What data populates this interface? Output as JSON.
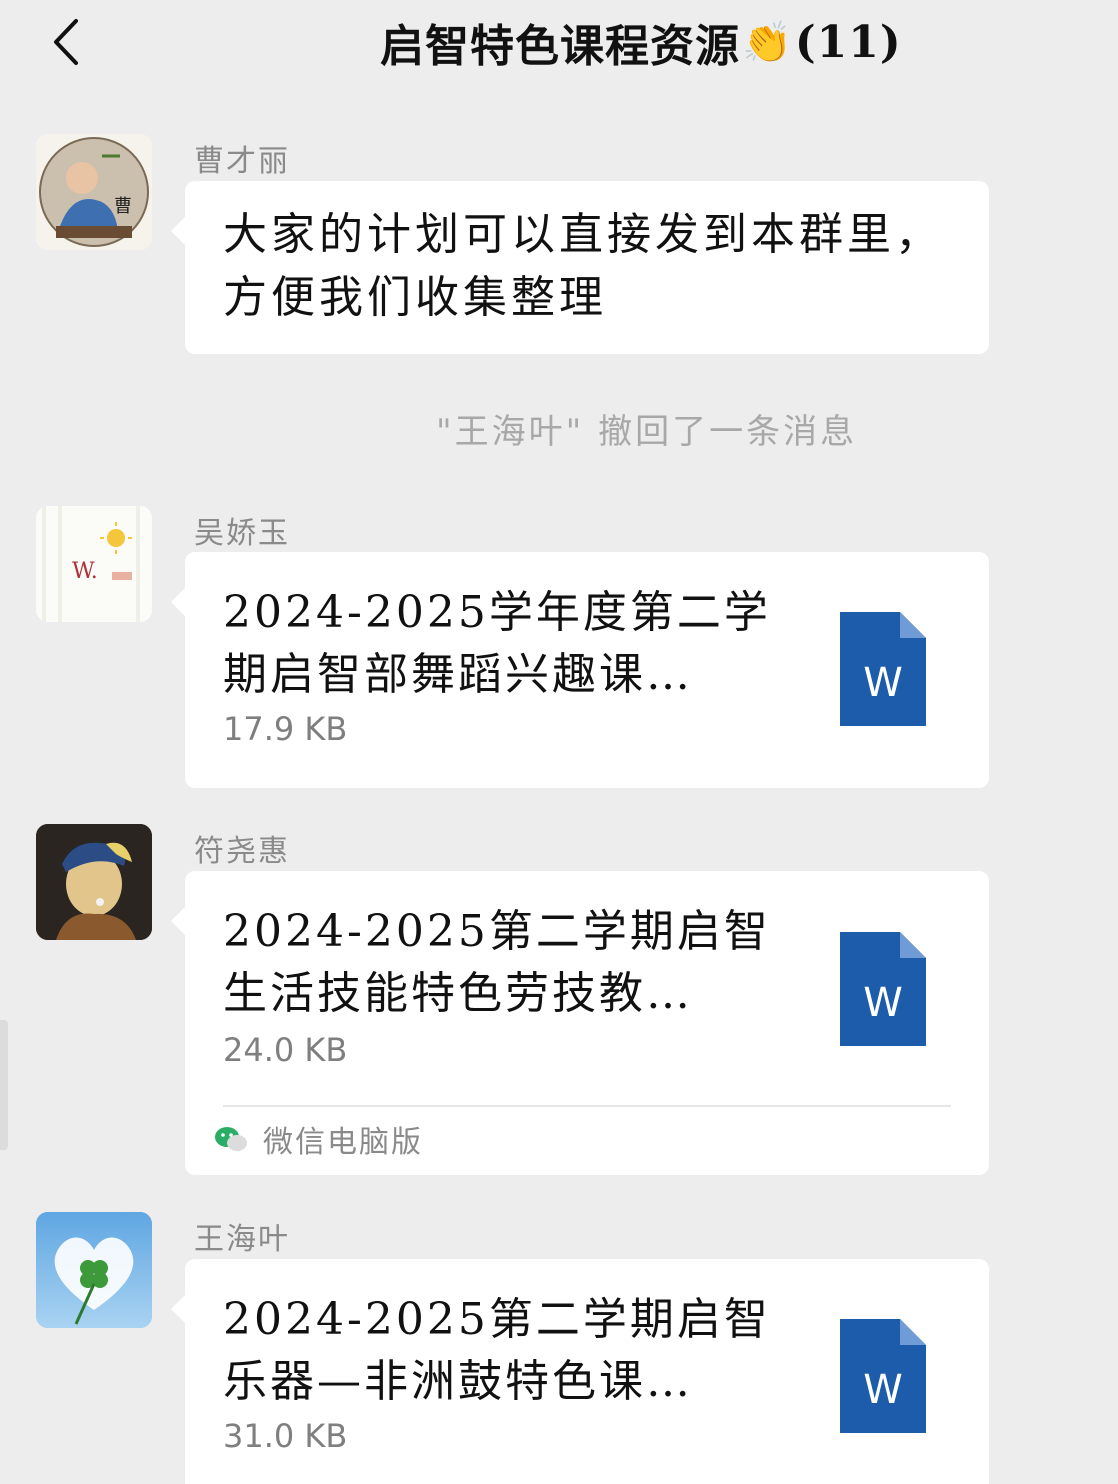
{
  "header": {
    "back_icon": "chevron-left-icon",
    "title_prefix": "启智特色课程资源",
    "title_emoji": "👏",
    "member_count": "(11)"
  },
  "messages": [
    {
      "sender": "曹才丽",
      "avatar": "avatar-monk-figurine",
      "avatar_badge": "曹",
      "type": "text",
      "text": "大家的计划可以直接发到本群里，方便我们收集整理"
    },
    {
      "sender": "吴娇玉",
      "avatar": "avatar-sun-doodle",
      "avatar_letter": "W.",
      "type": "file",
      "file_name": "2024-2025学年度第二学期启智部舞蹈兴趣课…",
      "file_size": "17.9 KB",
      "file_icon": "word-doc-icon",
      "file_icon_letter": "W"
    },
    {
      "sender": "符尧惠",
      "avatar": "avatar-painting-portrait",
      "type": "file",
      "file_name": "2024-2025第二学期启智生活技能特色劳技教…",
      "file_size": "24.0 KB",
      "file_icon": "word-doc-icon",
      "file_icon_letter": "W",
      "source": "微信电脑版",
      "source_icon": "wechat-icon"
    },
    {
      "sender": "王海叶",
      "avatar": "avatar-clover-heart-cloud",
      "type": "file",
      "file_name": "2024-2025第二学期启智乐器—非洲鼓特色课…",
      "file_size": "31.0 KB",
      "file_icon": "word-doc-icon",
      "file_icon_letter": "W"
    }
  ],
  "system_note": "\"王海叶\" 撤回了一条消息",
  "colors": {
    "background": "#ededed",
    "bubble": "#ffffff",
    "word_blue": "#1d5bab",
    "meta_gray": "#8a8a8a",
    "wechat_green": "#2aae67"
  }
}
